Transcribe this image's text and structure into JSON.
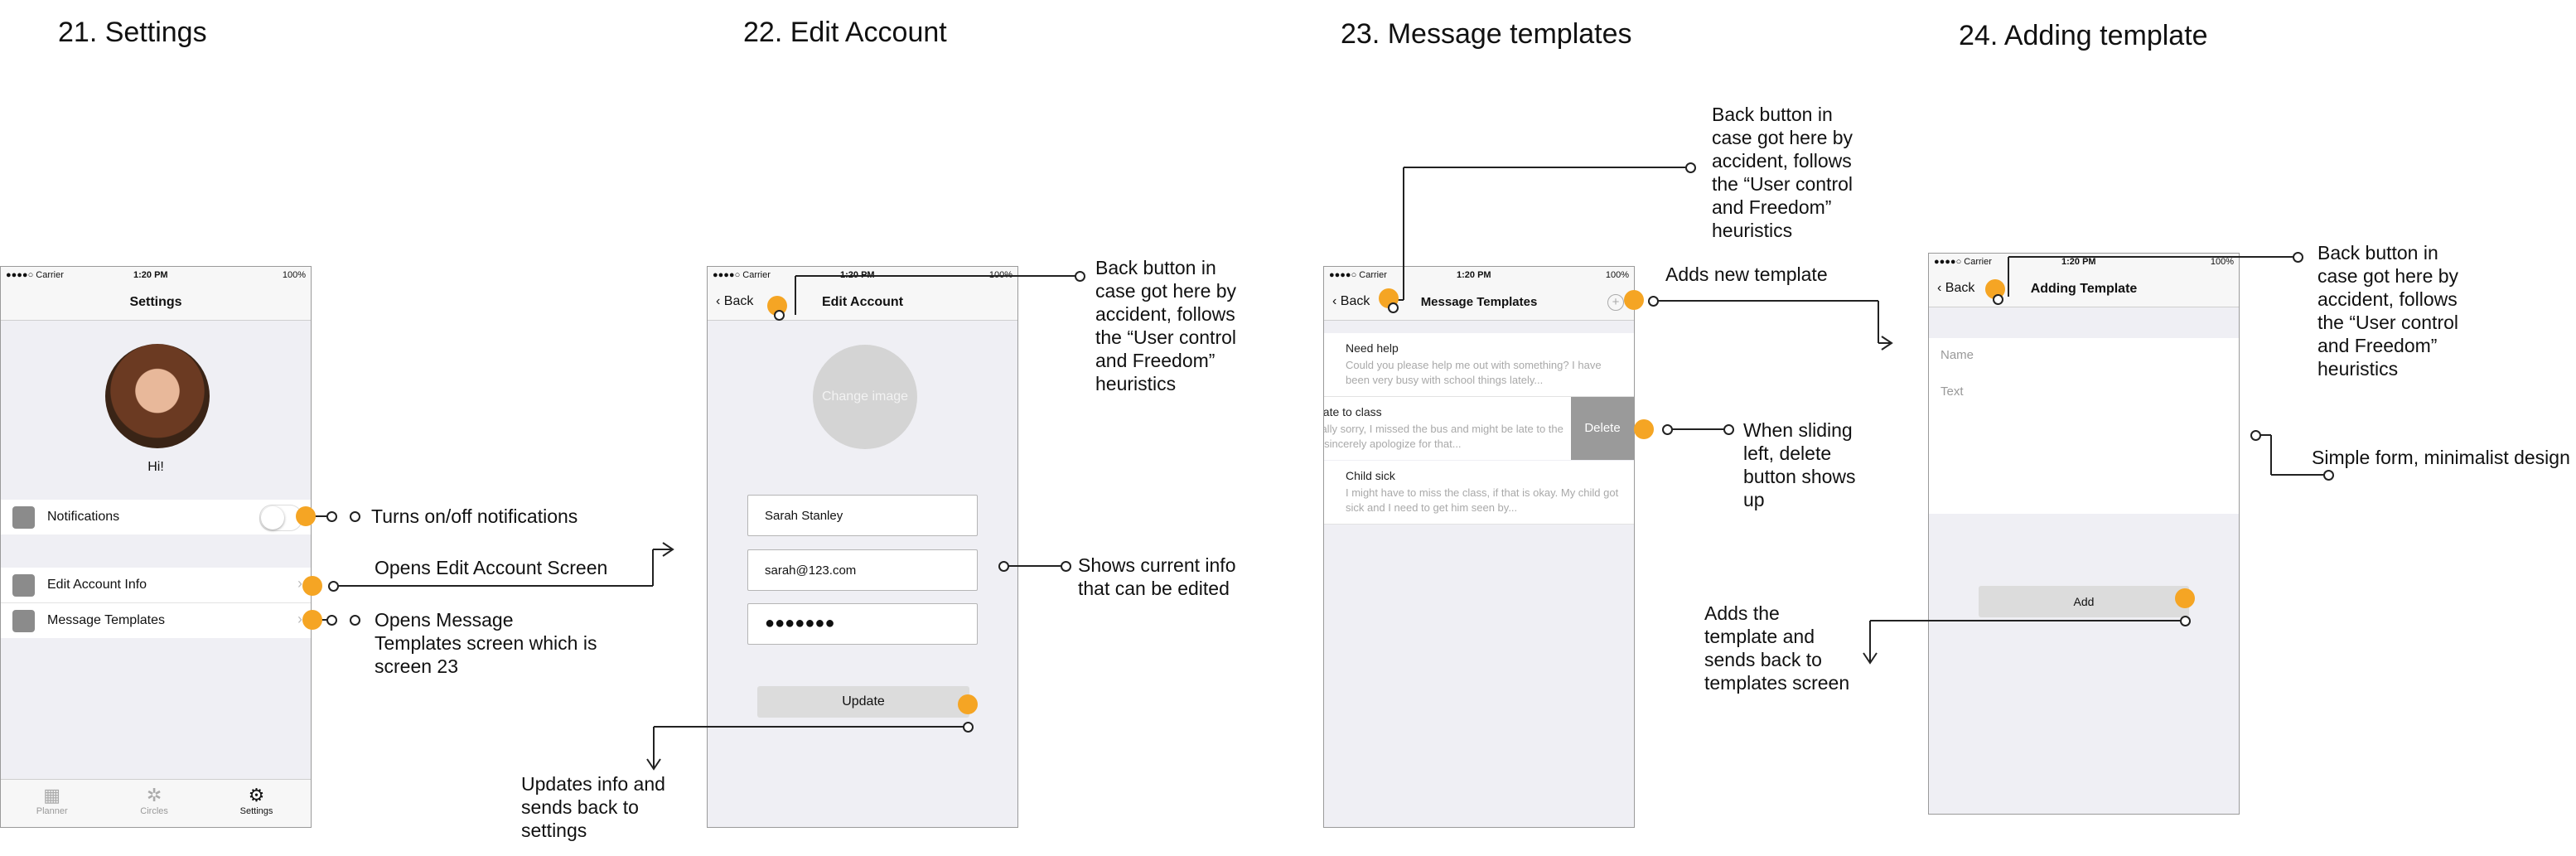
{
  "titles": {
    "s21": "21. Settings",
    "s22": "22. Edit Account",
    "s23": "23. Message templates",
    "s24": "24. Adding template"
  },
  "statusbar": {
    "carrier": "●●●●○ Carrier",
    "time": "1:20 PM",
    "battery": "100%"
  },
  "settings": {
    "nav_title": "Settings",
    "greeting": "Hi!",
    "rows": {
      "notifications": "Notifications",
      "edit_account": "Edit Account Info",
      "templates": "Message Templates"
    },
    "tabs": {
      "planner": "Planner",
      "circles": "Circles",
      "settings": "Settings"
    }
  },
  "edit_account": {
    "back": "Back",
    "nav_title": "Edit Account",
    "change_image": "Change image",
    "name": "Sarah Stanley",
    "email": "sarah@123.com",
    "password": "●●●●●●●",
    "update": "Update"
  },
  "templates": {
    "back": "Back",
    "nav_title": "Message Templates",
    "items": [
      {
        "title": "Need help",
        "desc": "Could you please help me out with something? I have been very busy with school things lately..."
      },
      {
        "title": "Being late to class",
        "desc": "I am really sorry, I missed the bus and might be late to the class. I sincerely apologize for that..."
      },
      {
        "title": "Child sick",
        "desc": "I might have to miss the class, if that is okay. My child got sick and I need to get him seen by..."
      }
    ],
    "delete": "Delete"
  },
  "adding": {
    "back": "Back",
    "nav_title": "Adding Template",
    "name_placeholder": "Name",
    "text_placeholder": "Text",
    "add": "Add"
  },
  "notes": {
    "notifications": "Turns on/off notifications",
    "edit_account": "Opens Edit Account Screen",
    "templates": "Opens Message\nTemplates screen which is\nscreen 23",
    "back22": "Back button in\ncase got here by\naccident, follows\nthe “User control\nand Freedom”\nheuristics",
    "current_info": "Shows current info\nthat can be edited",
    "updates": "Updates info and\nsends back to\nsettings",
    "back23": "Back button in\ncase got here by\naccident, follows\nthe “User control\nand Freedom”\nheuristics",
    "adds_new": "Adds new template",
    "sliding": "When sliding\nleft, delete\nbutton shows\nup",
    "adds_the": "Adds the\ntemplate and\nsends back to\ntemplates screen",
    "back24": "Back button in\ncase got here by\naccident, follows\nthe “User control\nand Freedom”\nheuristics",
    "simple_form": "Simple form, minimalist design"
  },
  "colors": {
    "marker": "#f5a524",
    "screen_bg": "#efeff4",
    "delete_bg": "#9a9a9a"
  }
}
